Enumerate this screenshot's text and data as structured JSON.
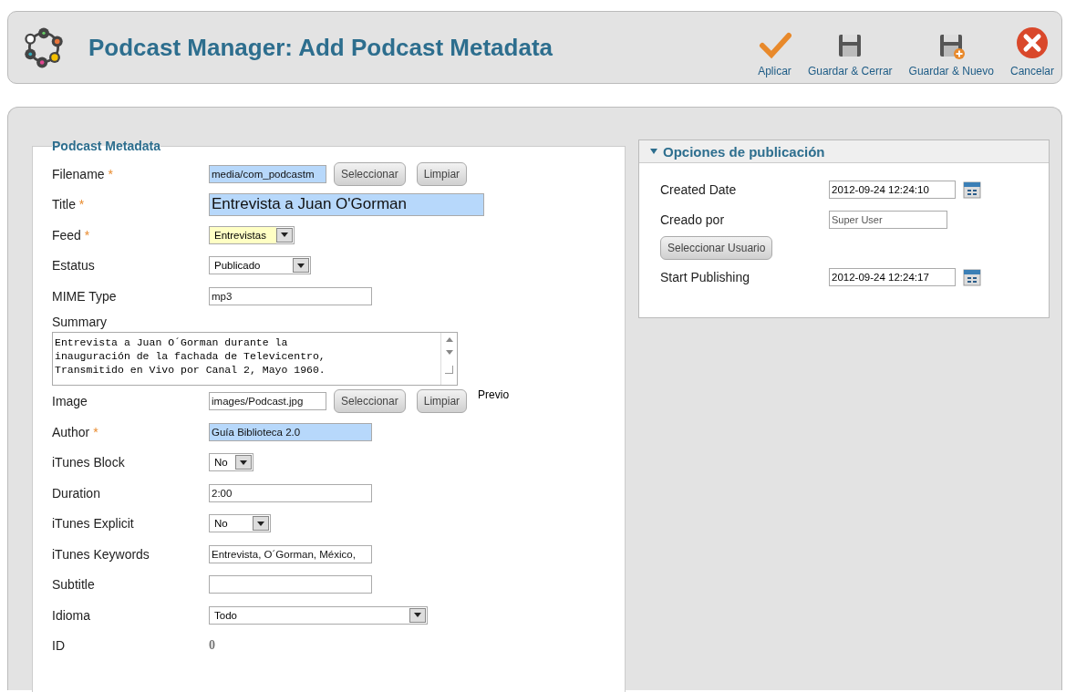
{
  "header": {
    "title": "Podcast Manager: Add Podcast Metadata"
  },
  "toolbar": [
    {
      "kind": "apply",
      "label": "Aplicar"
    },
    {
      "kind": "save",
      "label": "Guardar & Cerrar"
    },
    {
      "kind": "save-new",
      "label": "Guardar & Nuevo"
    },
    {
      "kind": "cancel",
      "label": "Cancelar"
    }
  ],
  "metadata": {
    "legend": "Podcast Metadata",
    "rows": [
      {
        "kind": "text",
        "label": "Filename",
        "mark": "*",
        "value": "media/com_podcastm",
        "color": "#b7d8fb",
        "buttons": [
          "Seleccionar",
          "Limpiar"
        ]
      },
      {
        "kind": "text",
        "label": "Title",
        "mark": "*",
        "value": "Entrevista a Juan O'Gorman",
        "color": "#b7d8fb"
      },
      {
        "kind": "select",
        "label": "Feed",
        "mark": "*",
        "value": "Entrevistas",
        "color": "#ffffc4"
      },
      {
        "kind": "select",
        "label": "Estatus",
        "value": "Publicado"
      },
      {
        "kind": "text",
        "label": "MIME Type",
        "value": "mp3"
      },
      {
        "kind": "textarea",
        "label": "Summary",
        "value": "Entrevista a Juan O´Gorman durante la\ninauguración de la fachada de Televicentro,\nTransmitido en Vivo por Canal 2, Mayo 1960."
      },
      {
        "kind": "text",
        "label": "Image",
        "value": "images/Podcast.jpg",
        "buttons": [
          "Seleccionar",
          "Limpiar"
        ],
        "note": "Previo"
      },
      {
        "kind": "text",
        "label": "Author",
        "mark": "*",
        "value": "Guía Biblioteca 2.0",
        "color": "#b7d8fb"
      },
      {
        "kind": "select",
        "label": "iTunes Block",
        "value": "No"
      },
      {
        "kind": "text",
        "label": "Duration",
        "value": "2:00"
      },
      {
        "kind": "select",
        "label": "iTunes Explicit",
        "value": "No"
      },
      {
        "kind": "text",
        "label": "iTunes Keywords",
        "value": "Entrevista, O´Gorman, México,"
      },
      {
        "kind": "text",
        "label": "Subtitle"
      },
      {
        "kind": "select",
        "label": "Idioma",
        "value": "Todo"
      },
      {
        "kind": "display",
        "label": "ID",
        "value": "0"
      }
    ]
  },
  "publishing": {
    "title": "Opciones de publicación",
    "expanded": true,
    "rows": [
      {
        "kind": "date",
        "label": "Created Date",
        "value": "2012-09-24 12:24:10"
      },
      {
        "kind": "user",
        "label": "Creado por",
        "value": "Super User",
        "button": "Seleccionar Usuario"
      },
      {
        "kind": "date",
        "label": "Start Publishing",
        "value": "2012-09-24 12:24:17"
      }
    ]
  }
}
